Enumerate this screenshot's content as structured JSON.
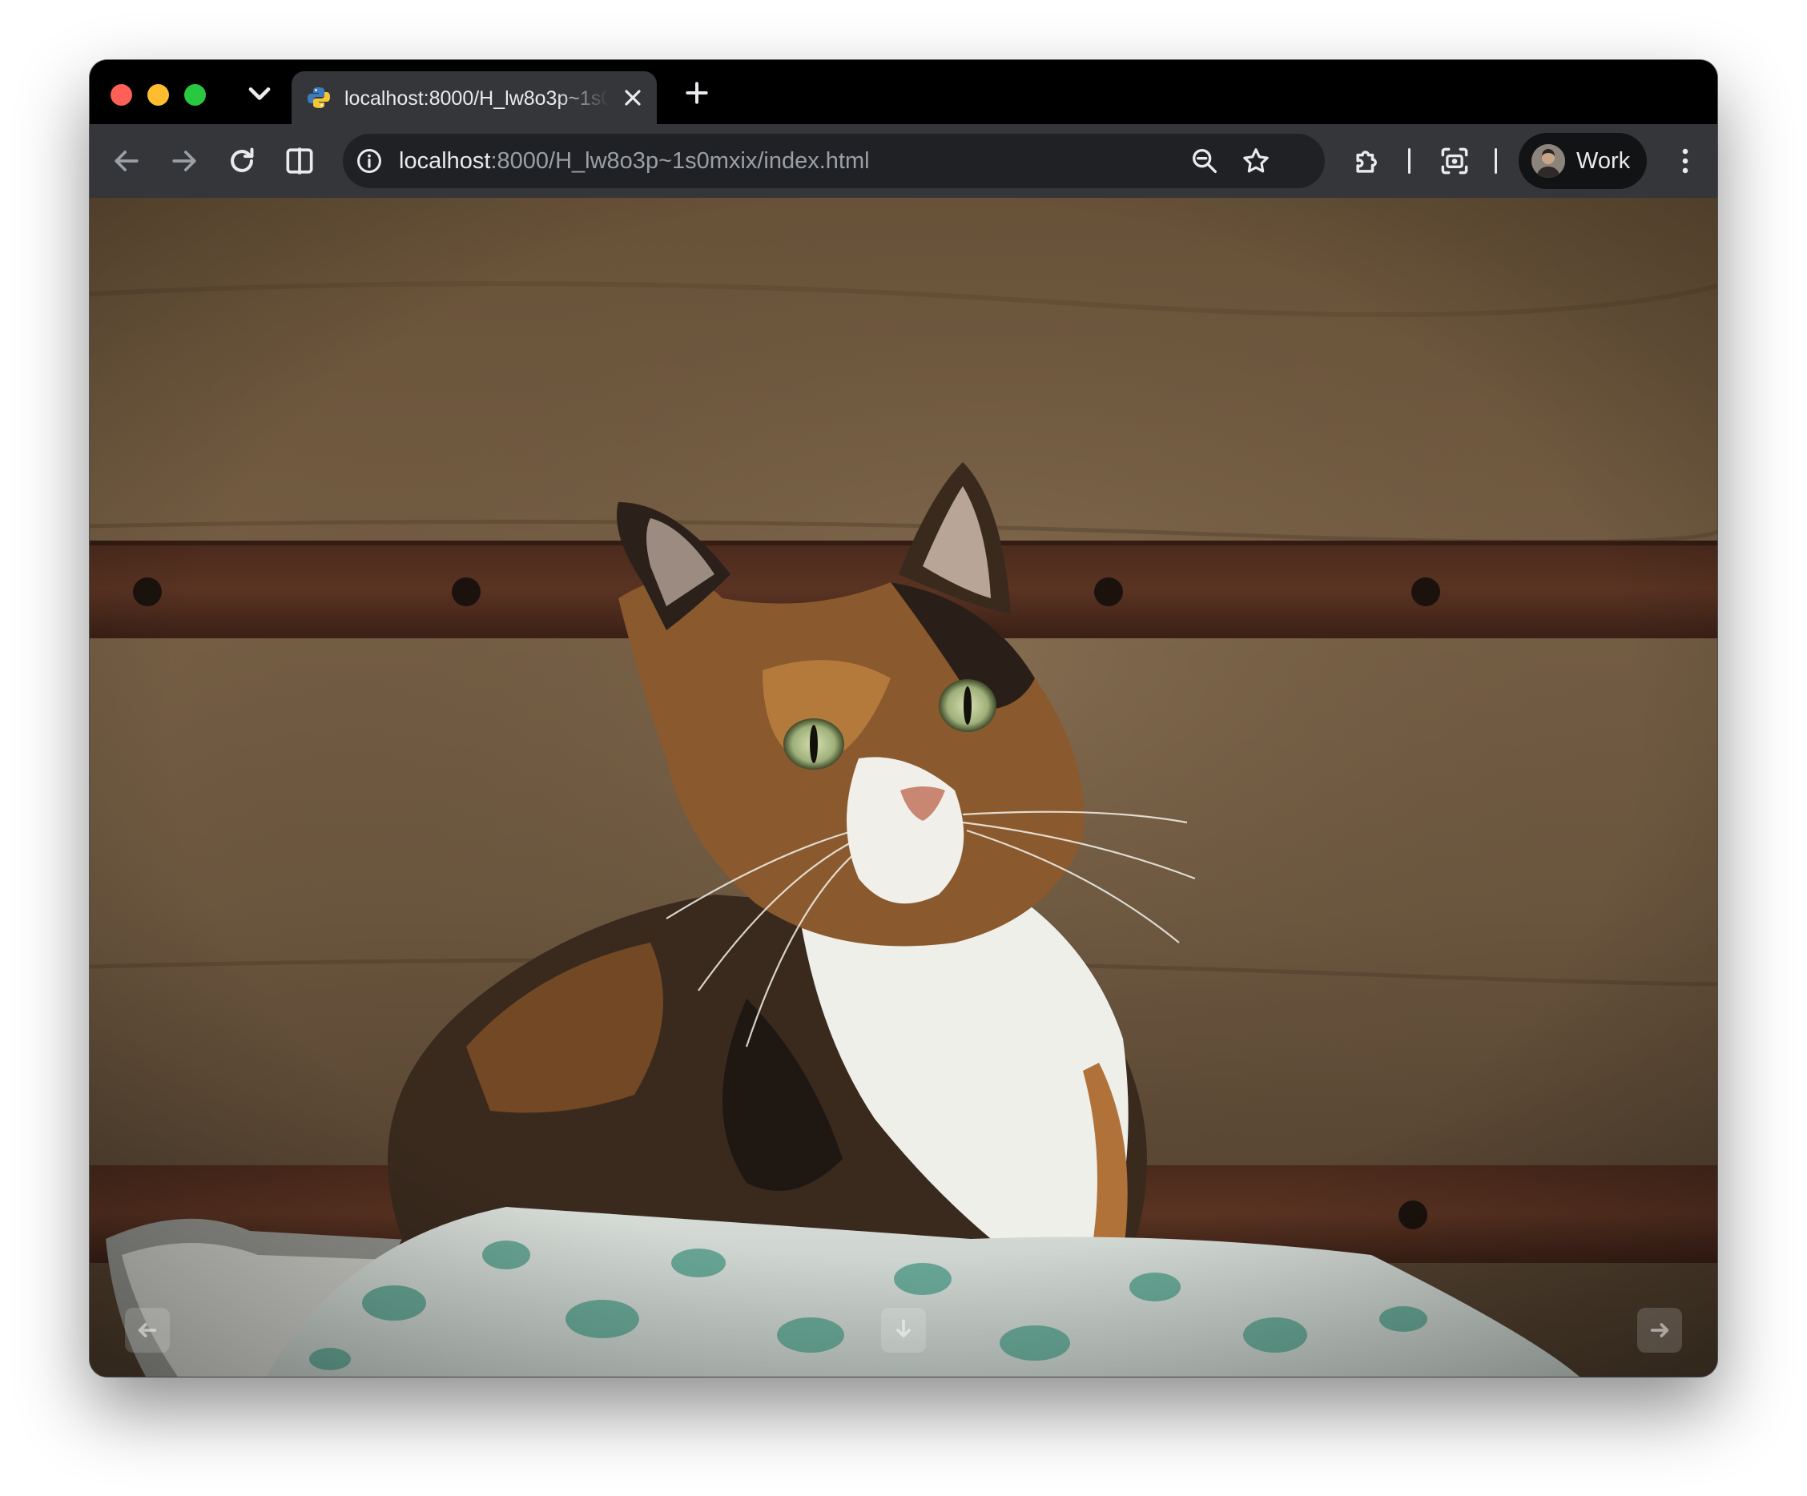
{
  "browser": {
    "tab": {
      "title": "localhost:8000/H_lw8o3p~1s0mxix/index.html",
      "favicon": "python-icon",
      "close_icon": "close-icon"
    },
    "tab_list_icon": "chevron-down-icon",
    "new_tab_icon": "plus-icon",
    "toolbar": {
      "back_icon": "arrow-left-icon",
      "forward_icon": "arrow-right-icon",
      "reload_icon": "reload-icon",
      "split_view_icon": "split-view-icon",
      "extensions_icon": "puzzle-icon",
      "screenshot_icon": "camera-capture-icon",
      "menu_icon": "more-vertical-icon"
    },
    "omnibox": {
      "url_host": "localhost",
      "url_rest": ":8000/H_lw8o3p~1s0mxix/index.html",
      "info_icon": "info-icon",
      "zoom_icon": "zoom-out-icon",
      "bookmark_icon": "star-icon"
    },
    "profile": {
      "label": "Work",
      "avatar_icon": "avatar-icon"
    }
  },
  "page": {
    "image_subject": "calico cat sitting in a basket with a floral cloth in front of a wooden wall",
    "nav_hints": {
      "prev_icon": "arrow-left-icon",
      "download_icon": "arrow-down-icon",
      "next_icon": "arrow-right-icon"
    }
  },
  "colors": {
    "tab_strip": "#000000",
    "toolbar": "#35363a",
    "omnibox": "#202124",
    "text": "#e8eaed",
    "muted_text": "#9aa0a6",
    "close_red": "#fe5f57",
    "minimize_yellow": "#febc2e",
    "zoom_green": "#28c840"
  }
}
